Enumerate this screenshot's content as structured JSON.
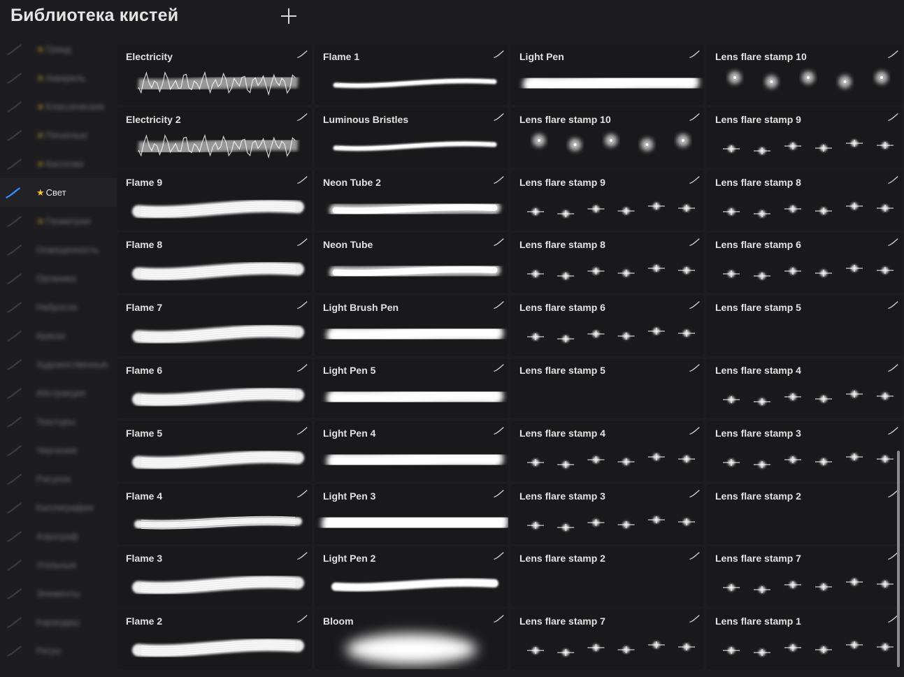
{
  "header": {
    "title": "Библиотека кистей"
  },
  "sidebar": {
    "active_index": 5,
    "items": [
      {
        "label": "Гранд",
        "star": true
      },
      {
        "label": "Акварель",
        "star": true
      },
      {
        "label": "Классические",
        "star": true
      },
      {
        "label": "Печатные",
        "star": true
      },
      {
        "label": "Кисточки",
        "star": true
      },
      {
        "label": "Свет",
        "star": true
      },
      {
        "label": "Геометрия",
        "star": true
      },
      {
        "label": "Освещенность",
        "star": false
      },
      {
        "label": "Органика",
        "star": false
      },
      {
        "label": "Набросок",
        "star": false
      },
      {
        "label": "Краски",
        "star": false
      },
      {
        "label": "Художественные",
        "star": false
      },
      {
        "label": "Абстракция",
        "star": false
      },
      {
        "label": "Текстуры",
        "star": false
      },
      {
        "label": "Черчение",
        "star": false
      },
      {
        "label": "Рисунок",
        "star": false
      },
      {
        "label": "Каллиграфия",
        "star": false
      },
      {
        "label": "Аэрограф",
        "star": false
      },
      {
        "label": "Угольные",
        "star": false
      },
      {
        "label": "Элементы",
        "star": false
      },
      {
        "label": "Карандаш",
        "star": false
      },
      {
        "label": "Ретро",
        "star": false
      }
    ]
  },
  "brush_columns": [
    [
      {
        "name": "Electricity",
        "preview": "electric"
      },
      {
        "name": "Electricity  2",
        "preview": "electric"
      },
      {
        "name": "Flame 9",
        "preview": "flame"
      },
      {
        "name": "Flame 8",
        "preview": "flame"
      },
      {
        "name": "Flame 7",
        "preview": "flame"
      },
      {
        "name": "Flame 6",
        "preview": "flame"
      },
      {
        "name": "Flame 5",
        "preview": "flame"
      },
      {
        "name": "Flame 4",
        "preview": "flame-thin"
      },
      {
        "name": "Flame 3",
        "preview": "flame"
      },
      {
        "name": "Flame 2",
        "preview": "flame"
      }
    ],
    [
      {
        "name": "Flame 1",
        "preview": "thin"
      },
      {
        "name": "Luminous Bristles",
        "preview": "thin"
      },
      {
        "name": "Neon Tube 2",
        "preview": "neon"
      },
      {
        "name": "Neon Tube",
        "preview": "neon"
      },
      {
        "name": "Light Brush Pen",
        "preview": "glow"
      },
      {
        "name": "Light Pen 5",
        "preview": "glow"
      },
      {
        "name": "Light Pen 4",
        "preview": "glow"
      },
      {
        "name": "Light Pen 3",
        "preview": "glow-wide"
      },
      {
        "name": "Light Pen 2",
        "preview": "thin-glow"
      },
      {
        "name": "Bloom",
        "preview": "bloom"
      }
    ],
    [
      {
        "name": "Light Pen",
        "preview": "glow"
      },
      {
        "name": "Lens flare stamp 10",
        "preview": "dots"
      },
      {
        "name": "Lens flare stamp 9",
        "preview": "sparks"
      },
      {
        "name": "Lens flare stamp 8",
        "preview": "sparks"
      },
      {
        "name": "Lens flare stamp 6",
        "preview": "sparks"
      },
      {
        "name": "Lens flare stamp 5",
        "preview": "dashes"
      },
      {
        "name": "Lens flare stamp 4",
        "preview": "sparks"
      },
      {
        "name": "Lens flare stamp 3",
        "preview": "sparks"
      },
      {
        "name": "Lens flare stamp 2",
        "preview": "dashes"
      },
      {
        "name": "Lens flare stamp 7",
        "preview": "sparks"
      }
    ],
    [
      {
        "name": "Lens flare stamp 10",
        "preview": "dots"
      },
      {
        "name": "Lens flare stamp 9",
        "preview": "sparks"
      },
      {
        "name": "Lens flare stamp 8",
        "preview": "sparks"
      },
      {
        "name": "Lens flare stamp 6",
        "preview": "sparks"
      },
      {
        "name": "Lens flare stamp 5",
        "preview": "dashes"
      },
      {
        "name": "Lens flare stamp 4",
        "preview": "sparks"
      },
      {
        "name": "Lens flare stamp 3",
        "preview": "sparks"
      },
      {
        "name": "Lens flare stamp 2",
        "preview": "dashes"
      },
      {
        "name": "Lens flare stamp 7",
        "preview": "sparks"
      },
      {
        "name": "Lens flare stamp 1",
        "preview": "sparks"
      }
    ]
  ],
  "colors": {
    "accent": "#2f8cff",
    "star": "#f2c531"
  },
  "icons": {
    "add": "plus-icon",
    "brush": "brush-icon",
    "star": "star-icon"
  }
}
